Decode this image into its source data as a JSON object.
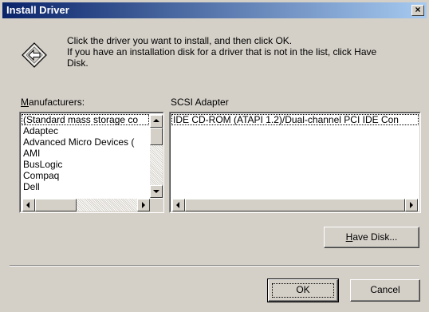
{
  "window": {
    "title": "Install Driver",
    "close_glyph": "×"
  },
  "intro": {
    "line1": "Click the driver you want to install, and then click OK.",
    "line2": "If you have an installation disk for a driver that is not in the list, click Have",
    "line3": "Disk."
  },
  "manufacturers": {
    "label_prefix": "M",
    "label_rest": "anufacturers:",
    "items": [
      "(Standard mass storage co",
      "Adaptec",
      "Advanced Micro Devices (",
      "AMI",
      "BusLogic",
      "Compaq",
      "Dell"
    ]
  },
  "models": {
    "label": "SCSI Adapter",
    "items": [
      "IDE CD-ROM (ATAPI 1.2)/Dual-channel PCI IDE Con"
    ]
  },
  "buttons": {
    "have_disk_prefix": "H",
    "have_disk_rest": "ave Disk...",
    "ok": "OK",
    "cancel": "Cancel"
  },
  "icons": {
    "driver": "diamond-arrow-icon",
    "close": "close-icon",
    "scroll_up": "arrow-up-icon",
    "scroll_down": "arrow-down-icon",
    "scroll_left": "arrow-left-icon",
    "scroll_right": "arrow-right-icon"
  }
}
